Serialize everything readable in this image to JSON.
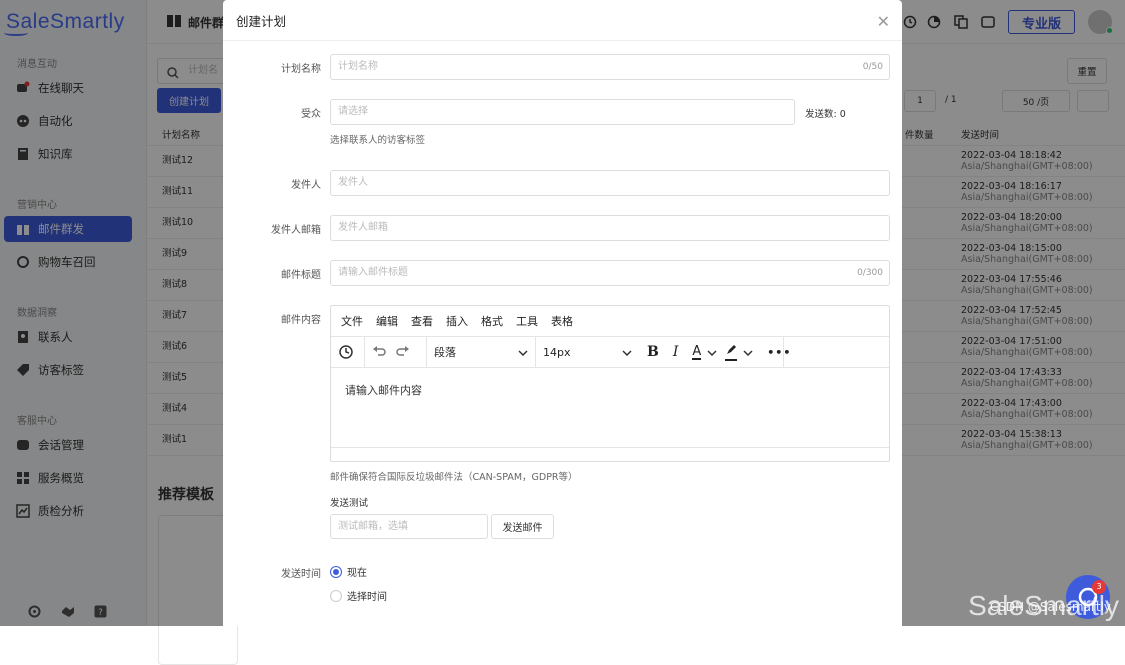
{
  "sidebar": {
    "logo": "SaleSmartly",
    "sections": [
      {
        "title": "消息互动",
        "items": [
          "在线聊天",
          "自动化",
          "知识库"
        ]
      },
      {
        "title": "营销中心",
        "items": [
          "邮件群发",
          "购物车召回"
        ]
      },
      {
        "title": "数据洞察",
        "items": [
          "联系人",
          "访客标签"
        ]
      },
      {
        "title": "客服中心",
        "items": [
          "会话管理",
          "服务概览",
          "质检分析"
        ]
      }
    ]
  },
  "topbar": {
    "title": "邮件群发",
    "plan_badge": "专业版"
  },
  "background": {
    "search_placeholder": "计划名",
    "create_button": "创建计划",
    "reset_button": "重置",
    "pager": {
      "page": "1",
      "total": "/ 1",
      "page_size": "50 /页"
    },
    "col_name": "计划名称",
    "col_count": "件数量",
    "col_time": "发送时间",
    "rows": [
      {
        "name": "测试12",
        "time": "2022-03-04 18:18:42",
        "tz": "Asia/Shanghai(GMT+08:00)"
      },
      {
        "name": "测试11",
        "time": "2022-03-04 18:16:17",
        "tz": "Asia/Shanghai(GMT+08:00)"
      },
      {
        "name": "测试10",
        "time": "2022-03-04 18:20:00",
        "tz": "Asia/Shanghai(GMT+08:00)"
      },
      {
        "name": "测试9",
        "time": "2022-03-04 18:15:00",
        "tz": "Asia/Shanghai(GMT+08:00)"
      },
      {
        "name": "测试8",
        "time": "2022-03-04 17:55:46",
        "tz": "Asia/Shanghai(GMT+08:00)"
      },
      {
        "name": "测试7",
        "time": "2022-03-04 17:52:45",
        "tz": "Asia/Shanghai(GMT+08:00)"
      },
      {
        "name": "测试6",
        "time": "2022-03-04 17:51:00",
        "tz": "Asia/Shanghai(GMT+08:00)"
      },
      {
        "name": "测试5",
        "time": "2022-03-04 17:43:33",
        "tz": "Asia/Shanghai(GMT+08:00)"
      },
      {
        "name": "测试4",
        "time": "2022-03-04 17:43:00",
        "tz": "Asia/Shanghai(GMT+08:00)"
      },
      {
        "name": "测试1",
        "time": "2022-03-04 15:38:13",
        "tz": "Asia/Shanghai(GMT+08:00)"
      }
    ],
    "templates_title": "推荐模板"
  },
  "modal": {
    "title": "创建计划",
    "fields": {
      "plan_name": {
        "label": "计划名称",
        "placeholder": "计划名称",
        "counter": "0/50"
      },
      "audience": {
        "label": "受众",
        "placeholder": "请选择",
        "send_count": "发送数: 0",
        "hint": "选择联系人的访客标签"
      },
      "sender": {
        "label": "发件人",
        "placeholder": "发件人"
      },
      "sender_email": {
        "label": "发件人邮箱",
        "placeholder": "发件人邮箱"
      },
      "subject": {
        "label": "邮件标题",
        "placeholder": "请输入邮件标题",
        "counter": "0/300"
      },
      "content": {
        "label": "邮件内容"
      }
    },
    "editor": {
      "menus": [
        "文件",
        "编辑",
        "查看",
        "插入",
        "格式",
        "工具",
        "表格"
      ],
      "block_format": "段落",
      "font_size": "14px",
      "placeholder": "请输入邮件内容"
    },
    "compliance_note": "邮件确保符合国际反垃圾邮件法（CAN-SPAM，GDPR等）",
    "test_send": {
      "label": "发送测试",
      "placeholder": "测试邮箱，选填",
      "button": "发送邮件"
    },
    "send_time": {
      "label": "发送时间",
      "options": [
        "现在",
        "选择时间"
      ],
      "selected": "现在"
    }
  },
  "chat_widget": {
    "badge": "3"
  },
  "watermark": {
    "logo": "SaleSmartly",
    "text": "CSDN @Salesmartly"
  },
  "colors": {
    "primary": "#3d5bdb",
    "danger": "#e53935"
  }
}
